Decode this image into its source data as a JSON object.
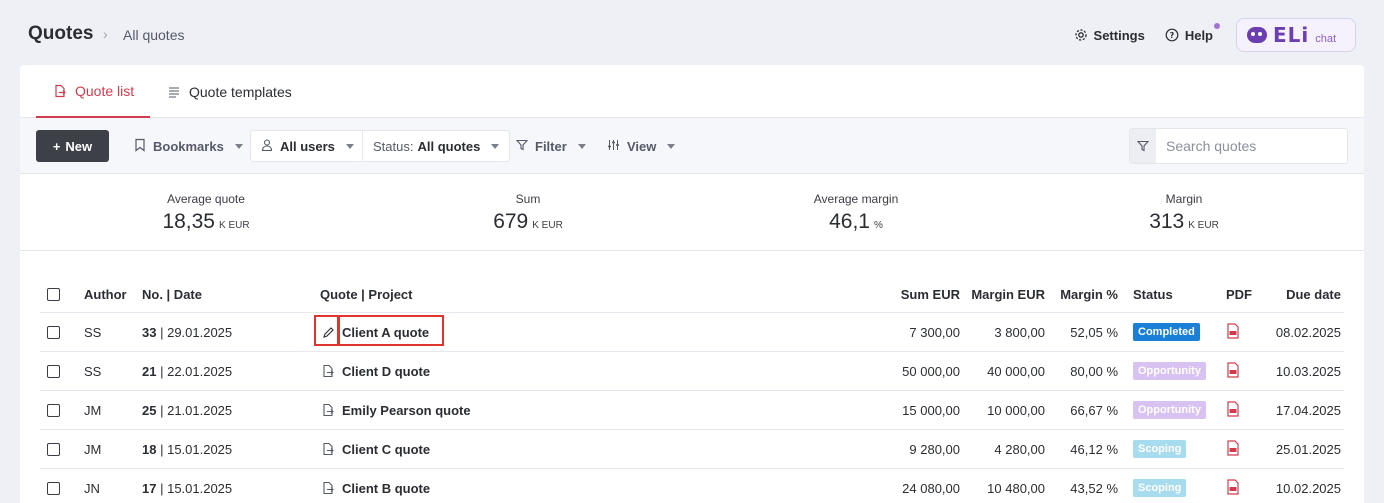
{
  "breadcrumb": {
    "title": "Quotes",
    "separator": "›",
    "current": "All quotes"
  },
  "top_actions": {
    "settings": "Settings",
    "help": "Help",
    "eli_logo": "ELi",
    "eli_sub": "chat"
  },
  "tabs": [
    {
      "label": "Quote list",
      "active": true
    },
    {
      "label": "Quote templates",
      "active": false
    }
  ],
  "toolbar": {
    "new_label": "New",
    "bookmarks": "Bookmarks",
    "users": "All users",
    "status_prefix": "Status:",
    "status_value": "All quotes",
    "filter": "Filter",
    "view": "View",
    "search_placeholder": "Search quotes"
  },
  "stats": [
    {
      "label": "Average quote",
      "value": "18,35",
      "unit": "K  EUR"
    },
    {
      "label": "Sum",
      "value": "679",
      "unit": "K  EUR"
    },
    {
      "label": "Average margin",
      "value": "46,1",
      "unit": "%"
    },
    {
      "label": "Margin",
      "value": "313",
      "unit": "K  EUR"
    }
  ],
  "table": {
    "headers": {
      "author": "Author",
      "no_date": "No. | Date",
      "quote": "Quote | Project",
      "sum": "Sum EUR",
      "margin": "Margin EUR",
      "margin_pct": "Margin %",
      "status": "Status",
      "pdf": "PDF",
      "due": "Due date"
    },
    "rows": [
      {
        "author": "SS",
        "no": "33",
        "date": "| 29.01.2025",
        "quote": "Client A quote",
        "sum": "7 300,00",
        "margin": "3 800,00",
        "pct": "52,05 %",
        "status": "Completed",
        "due": "08.02.2025"
      },
      {
        "author": "SS",
        "no": "21",
        "date": "| 22.01.2025",
        "quote": "Client D quote",
        "sum": "50 000,00",
        "margin": "40 000,00",
        "pct": "80,00 %",
        "status": "Opportunity",
        "due": "10.03.2025"
      },
      {
        "author": "JM",
        "no": "25",
        "date": "| 21.01.2025",
        "quote": "Emily Pearson quote",
        "sum": "15 000,00",
        "margin": "10 000,00",
        "pct": "66,67 %",
        "status": "Opportunity",
        "due": "17.04.2025"
      },
      {
        "author": "JM",
        "no": "18",
        "date": "| 15.01.2025",
        "quote": "Client C quote",
        "sum": "9 280,00",
        "margin": "4 280,00",
        "pct": "46,12 %",
        "status": "Scoping",
        "due": "25.01.2025"
      },
      {
        "author": "JN",
        "no": "17",
        "date": "| 15.01.2025",
        "quote": "Client B quote",
        "sum": "24 080,00",
        "margin": "10 480,00",
        "pct": "43,52 %",
        "status": "Scoping",
        "due": "10.02.2025"
      }
    ]
  },
  "colors": {
    "accent": "#d03c4e",
    "completed": "#1a7fd6",
    "opportunity": "#d8c2f2",
    "scoping": "#a7dcee",
    "highlight": "#e0342f"
  }
}
